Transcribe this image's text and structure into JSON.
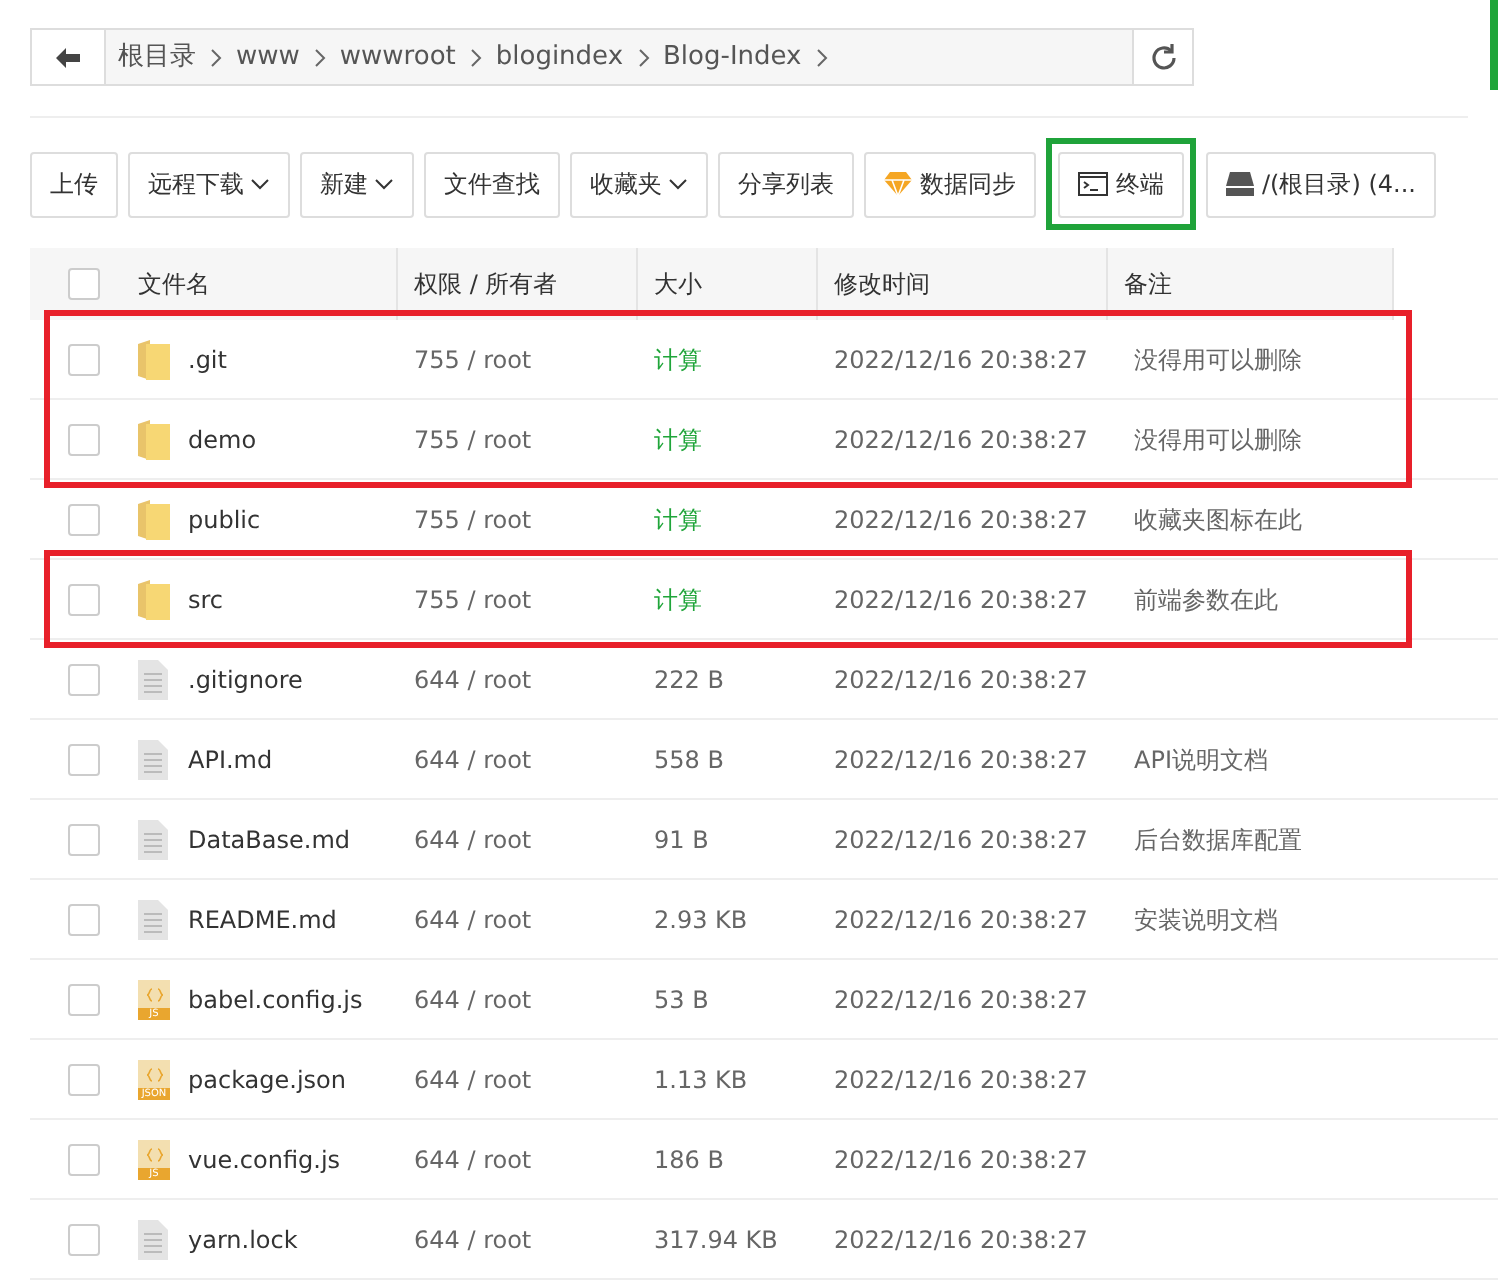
{
  "breadcrumb": {
    "items": [
      "根目录",
      "www",
      "wwwroot",
      "blogindex",
      "Blog-Index"
    ]
  },
  "toolbar": [
    {
      "label": "上传",
      "dropdown": false,
      "kind": "plain",
      "highlighted": false
    },
    {
      "label": "远程下载",
      "dropdown": true,
      "kind": "plain",
      "highlighted": false
    },
    {
      "label": "新建",
      "dropdown": true,
      "kind": "plain",
      "highlighted": false
    },
    {
      "label": "文件查找",
      "dropdown": false,
      "kind": "plain",
      "highlighted": false
    },
    {
      "label": "收藏夹",
      "dropdown": true,
      "kind": "plain",
      "highlighted": false
    },
    {
      "label": "分享列表",
      "dropdown": false,
      "kind": "plain",
      "highlighted": false
    },
    {
      "label": "数据同步",
      "dropdown": false,
      "kind": "sync",
      "highlighted": false
    },
    {
      "label": "终端",
      "dropdown": false,
      "kind": "terminal",
      "highlighted": true
    },
    {
      "label": "/(根目录) (4...",
      "dropdown": false,
      "kind": "disk",
      "highlighted": false
    }
  ],
  "table": {
    "select_all_checked": false,
    "columns": [
      "文件名",
      "权限 / 所有者",
      "大小",
      "修改时间",
      "备注"
    ],
    "rows": [
      {
        "kind": "folder",
        "name": ".git",
        "perm": "755 / root",
        "size": "计算",
        "mtime": "2022/12/16 20:38:27",
        "note": "没得用可以删除",
        "checked": false,
        "highlighted": true
      },
      {
        "kind": "folder",
        "name": "demo",
        "perm": "755 / root",
        "size": "计算",
        "mtime": "2022/12/16 20:38:27",
        "note": "没得用可以删除",
        "checked": false,
        "highlighted": true
      },
      {
        "kind": "folder",
        "name": "public",
        "perm": "755 / root",
        "size": "计算",
        "mtime": "2022/12/16 20:38:27",
        "note": "收藏夹图标在此",
        "checked": false,
        "highlighted": false
      },
      {
        "kind": "folder",
        "name": "src",
        "perm": "755 / root",
        "size": "计算",
        "mtime": "2022/12/16 20:38:27",
        "note": "前端参数在此",
        "checked": false,
        "highlighted": true
      },
      {
        "kind": "file",
        "name": ".gitignore",
        "perm": "644 / root",
        "size": "222 B",
        "mtime": "2022/12/16 20:38:27",
        "checked": false,
        "highlighted": false
      },
      {
        "kind": "file",
        "name": "API.md",
        "perm": "644 / root",
        "size": "558 B",
        "mtime": "2022/12/16 20:38:27",
        "note": "API说明文档",
        "checked": false,
        "highlighted": false
      },
      {
        "kind": "file",
        "name": "DataBase.md",
        "perm": "644 / root",
        "size": "91 B",
        "mtime": "2022/12/16 20:38:27",
        "note": "后台数据库配置",
        "checked": false,
        "highlighted": false
      },
      {
        "kind": "file",
        "name": "README.md",
        "perm": "644 / root",
        "size": "2.93 KB",
        "mtime": "2022/12/16 20:38:27",
        "note": "安装说明文档",
        "checked": false,
        "highlighted": false
      },
      {
        "kind": "code",
        "icon_label": "JS",
        "name": "babel.config.js",
        "perm": "644 / root",
        "size": "53 B",
        "mtime": "2022/12/16 20:38:27",
        "checked": false,
        "highlighted": false
      },
      {
        "kind": "code",
        "icon_label": "JSON",
        "name": "package.json",
        "perm": "644 / root",
        "size": "1.13 KB",
        "mtime": "2022/12/16 20:38:27",
        "checked": false,
        "highlighted": false
      },
      {
        "kind": "code",
        "icon_label": "JS",
        "name": "vue.config.js",
        "perm": "644 / root",
        "size": "186 B",
        "mtime": "2022/12/16 20:38:27",
        "checked": false,
        "highlighted": false
      },
      {
        "kind": "file",
        "name": "yarn.lock",
        "perm": "644 / root",
        "size": "317.94 KB",
        "mtime": "2022/12/16 20:38:27",
        "checked": false,
        "highlighted": false
      }
    ]
  }
}
